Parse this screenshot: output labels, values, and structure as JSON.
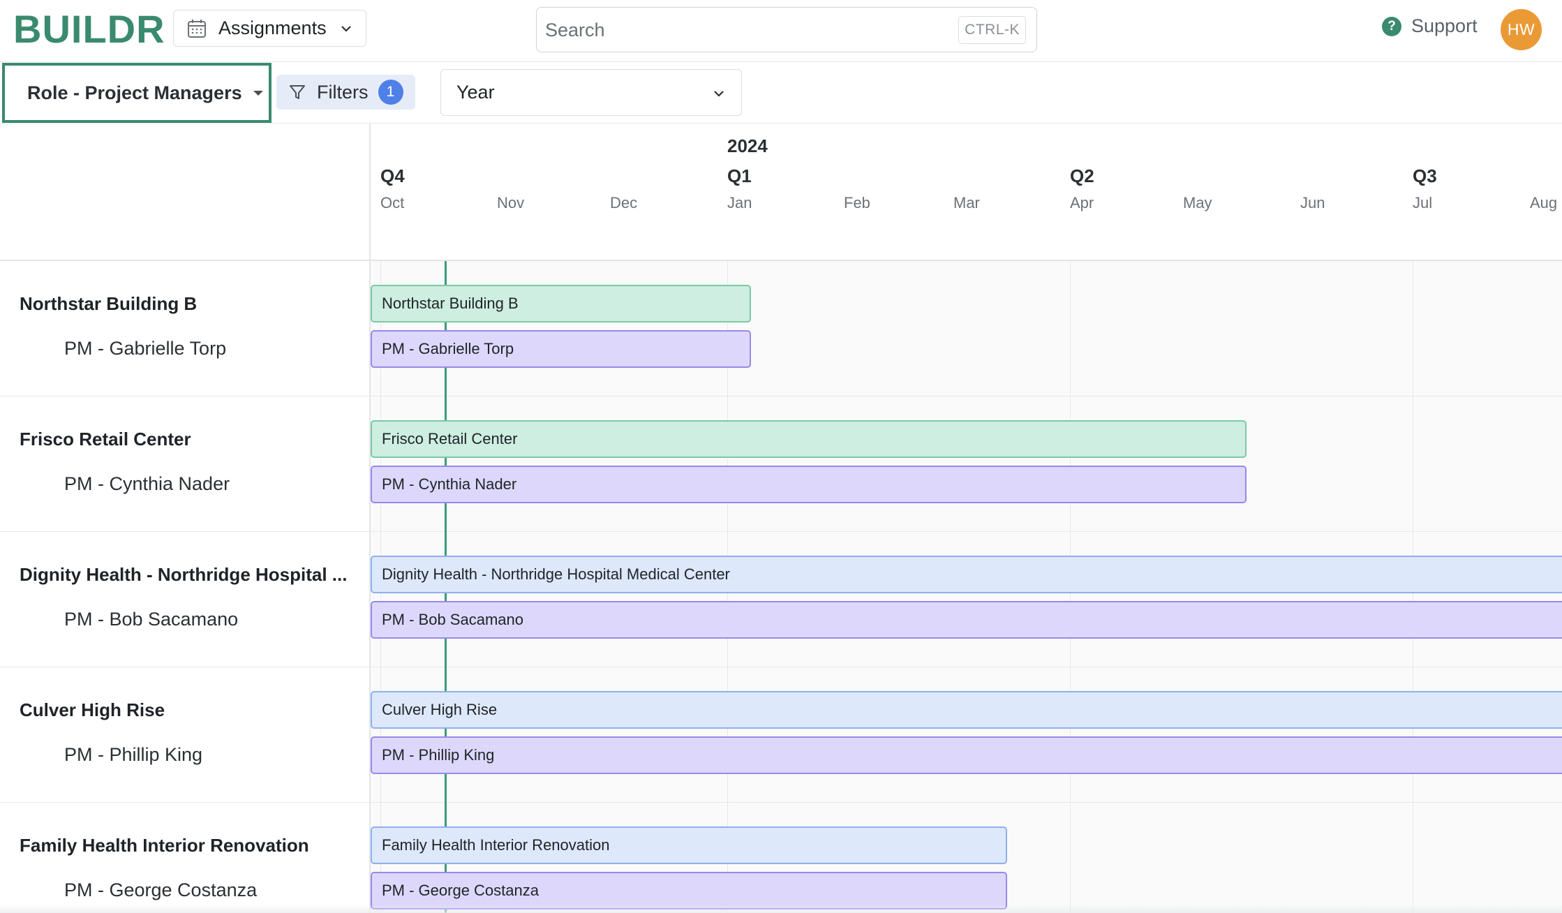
{
  "app": {
    "logo": "BUILDR",
    "nav_selector": "Assignments",
    "search": {
      "placeholder": "Search",
      "shortcut": "CTRL-K"
    },
    "support_label": "Support",
    "user_initials": "HW",
    "accent_color": "#3a8a6e"
  },
  "toolbar": {
    "group_by": "Role - Project Managers",
    "filters_label": "Filters",
    "filters_count": "1",
    "range": "Year"
  },
  "timeline": {
    "year": "2024",
    "quarters": [
      "Q4",
      "Q1",
      "Q2",
      "Q3"
    ],
    "months": [
      "Oct",
      "Nov",
      "Dec",
      "Jan",
      "Feb",
      "Mar",
      "Apr",
      "May",
      "Jun",
      "Jul",
      "Aug"
    ]
  },
  "projects": [
    {
      "name": "Northstar Building B",
      "pm": "PM - Gabrielle Torp",
      "bar_label": "Northstar Building B",
      "pm_bar_label": "PM - Gabrielle Torp",
      "color": "green",
      "end_month_index": 3.25,
      "open_end": false
    },
    {
      "name": "Frisco Retail Center",
      "pm": "PM - Cynthia Nader",
      "bar_label": "Frisco Retail Center",
      "pm_bar_label": "PM - Cynthia Nader",
      "color": "green",
      "end_month_index": 7.6,
      "open_end": false
    },
    {
      "name": "Dignity Health - Northridge Hospital ...",
      "pm": "PM - Bob Sacamano",
      "bar_label": "Dignity Health - Northridge Hospital Medical Center",
      "pm_bar_label": "PM - Bob Sacamano",
      "color": "blue",
      "end_month_index": null,
      "open_end": true
    },
    {
      "name": "Culver High Rise",
      "pm": "PM - Phillip King",
      "bar_label": "Culver High Rise",
      "pm_bar_label": "PM - Phillip King",
      "color": "blue",
      "end_month_index": null,
      "open_end": true
    },
    {
      "name": "Family Health Interior Renovation",
      "pm": "PM - George Costanza",
      "bar_label": "Family Health Interior Renovation",
      "pm_bar_label": "PM - George Costanza",
      "color": "blue",
      "end_month_index": 5.5,
      "open_end": false
    }
  ]
}
